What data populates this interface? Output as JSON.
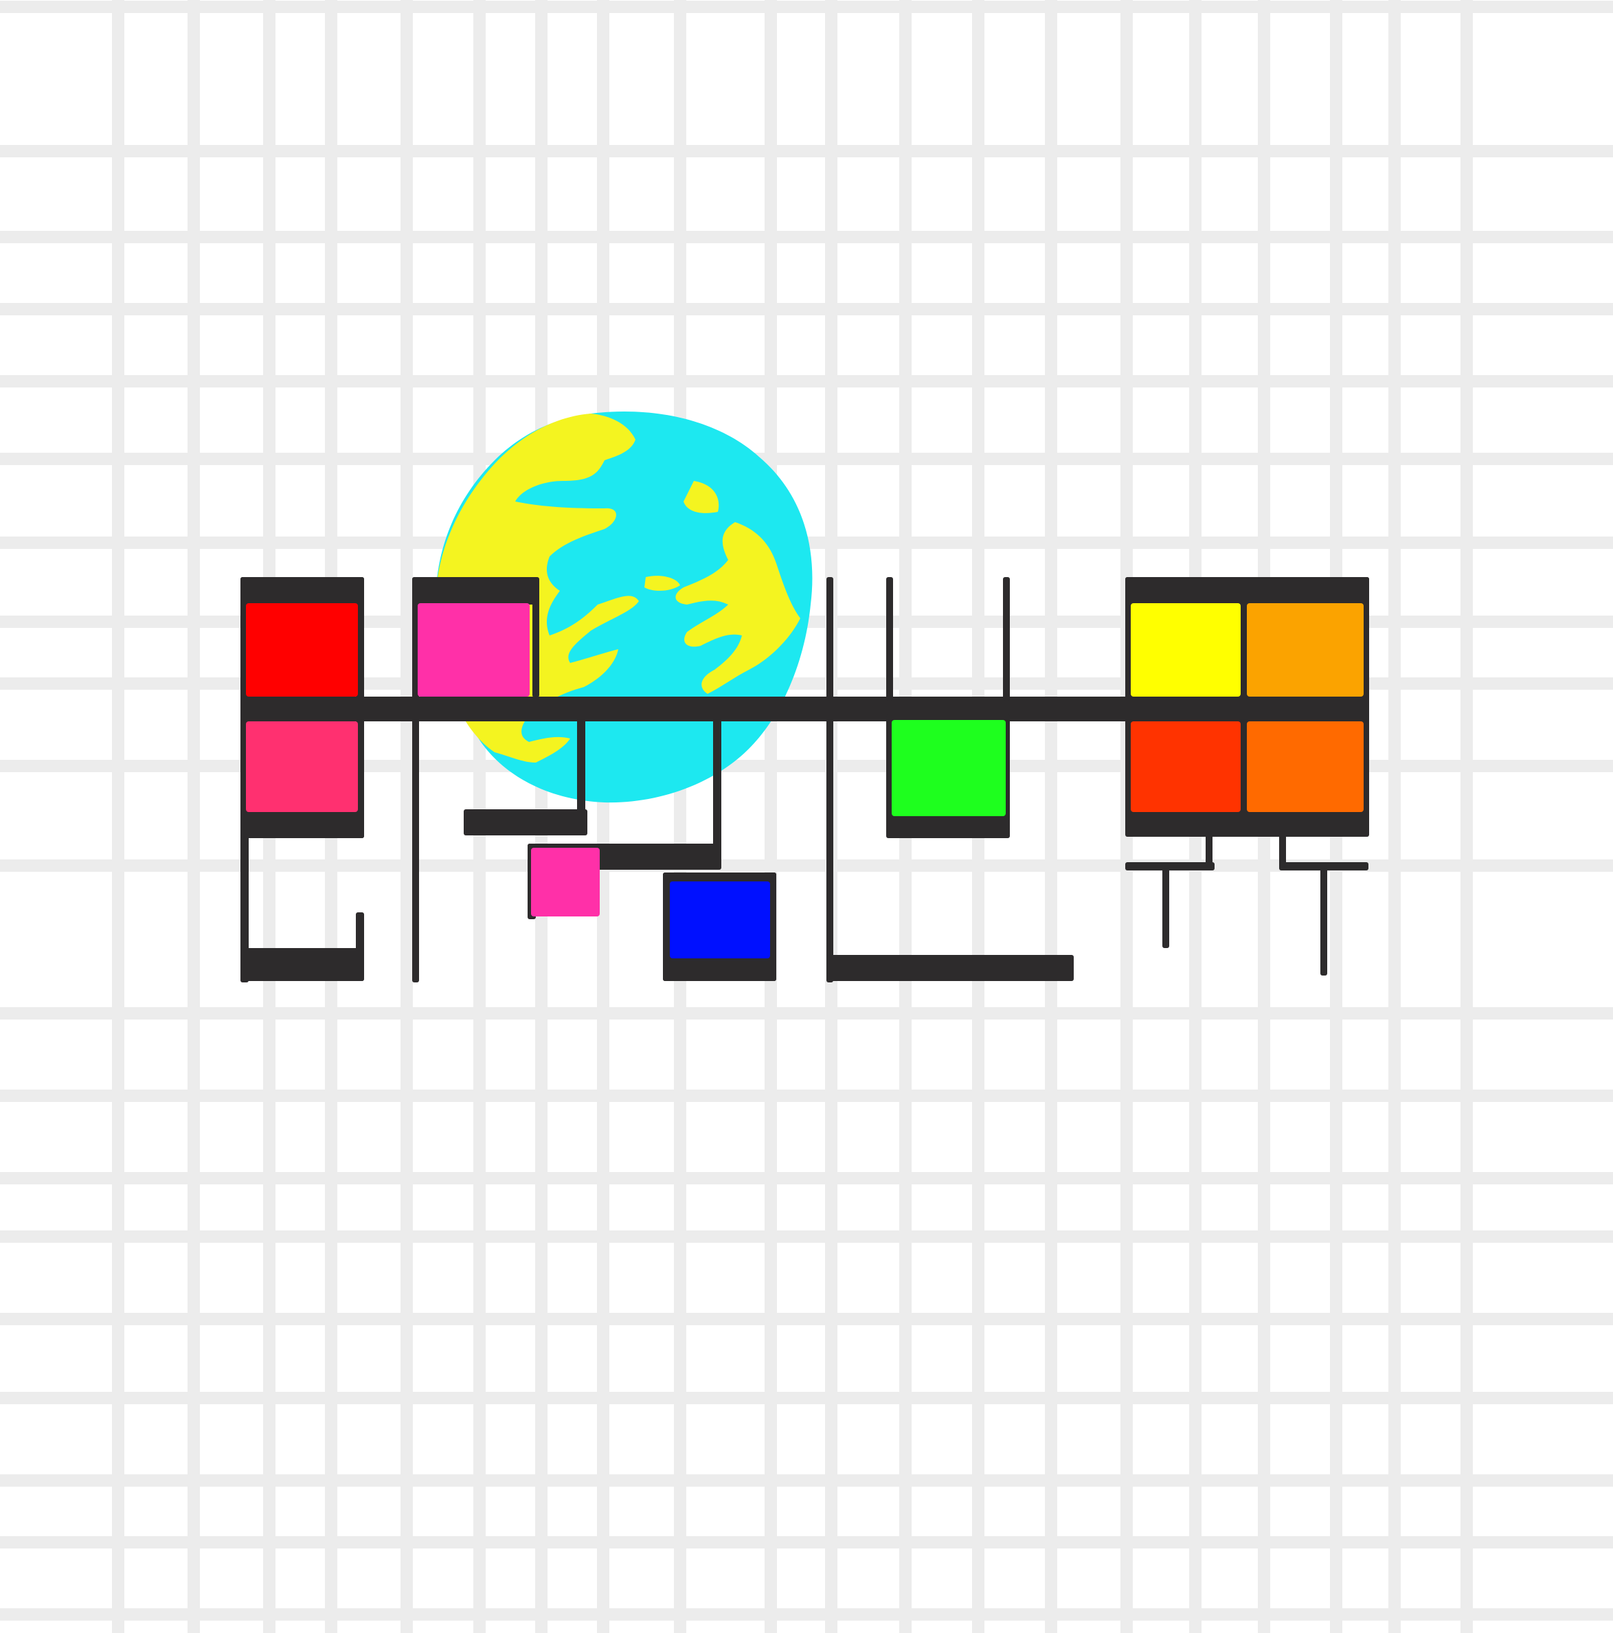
{
  "artwork": {
    "kind": "abstract geometric logo on grid background",
    "has_text": false
  },
  "colors": {
    "background": "#ffffff",
    "grid_line": "#ececec",
    "frame": "#2d2b2c",
    "globe_ocean": "#1de8f0",
    "globe_land": "#f4f420",
    "tile_red": "#ff0000",
    "tile_magenta": "#ff30a8",
    "tile_rose": "#ff3070",
    "tile_pink_small": "#ff30a8",
    "tile_blue": "#0010ff",
    "tile_green": "#1eff1e",
    "tile_yellow": "#ffff00",
    "tile_amber": "#fba300",
    "tile_orange_red": "#ff3300",
    "tile_orange": "#ff6a00"
  },
  "icons": {
    "globe": "globe-icon"
  },
  "tiles": [
    {
      "id": "tile-red",
      "color_key": "tile_red"
    },
    {
      "id": "tile-magenta",
      "color_key": "tile_magenta"
    },
    {
      "id": "tile-rose",
      "color_key": "tile_rose"
    },
    {
      "id": "tile-pink-small",
      "color_key": "tile_pink_small"
    },
    {
      "id": "tile-blue",
      "color_key": "tile_blue"
    },
    {
      "id": "tile-green",
      "color_key": "tile_green"
    },
    {
      "id": "tile-yellow",
      "color_key": "tile_yellow"
    },
    {
      "id": "tile-amber",
      "color_key": "tile_amber"
    },
    {
      "id": "tile-orange-red",
      "color_key": "tile_orange_red"
    },
    {
      "id": "tile-orange",
      "color_key": "tile_orange"
    }
  ]
}
